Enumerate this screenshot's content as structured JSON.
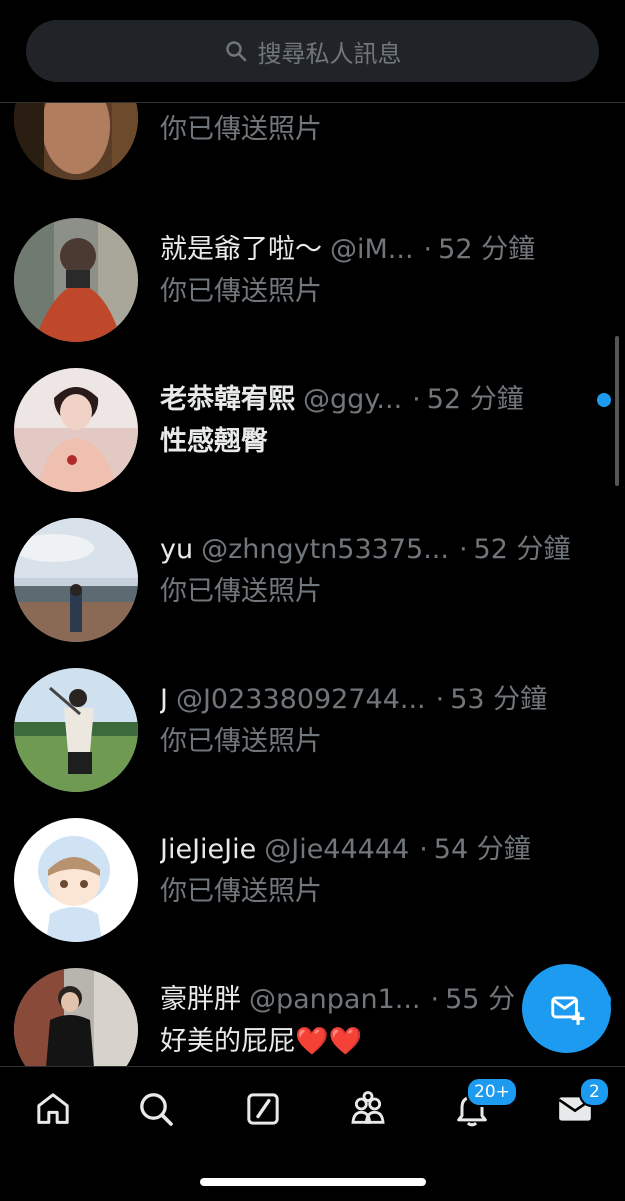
{
  "search": {
    "placeholder": "搜尋私人訊息",
    "icon": "search-icon"
  },
  "conversations": [
    {
      "name": "",
      "handle": "",
      "time": "",
      "preview": "你已傳送照片",
      "unread": false
    },
    {
      "name": "就是爺了啦～",
      "handle": "@iM...",
      "time": "52 分鐘",
      "preview": "你已傳送照片",
      "unread": false
    },
    {
      "name": "老恭韓宥熙",
      "handle": "@ggy...",
      "time": "52 分鐘",
      "preview": "性感翹臀",
      "unread": true
    },
    {
      "name": "yu",
      "handle": "@zhngytn53375...",
      "time": "52 分鐘",
      "preview": "你已傳送照片",
      "unread": false
    },
    {
      "name": "J",
      "handle": "@J02338092744...",
      "time": "53 分鐘",
      "preview": "你已傳送照片",
      "unread": false
    },
    {
      "name": "JieJieJie",
      "handle": "@Jie44444",
      "time": "54 分鐘",
      "preview": "你已傳送照片",
      "unread": false
    },
    {
      "name": "豪胖胖",
      "handle": "@panpan1...",
      "time": "55 分",
      "preview": "好美的屁屁❤️❤️",
      "unread": true
    }
  ],
  "bottom_nav": {
    "items": [
      "home-icon",
      "search-icon",
      "grok-icon",
      "communities-icon",
      "notifications-icon",
      "messages-icon"
    ],
    "notifications_badge": "20+",
    "messages_badge": "2"
  },
  "fab": {
    "icon": "new-message-icon"
  },
  "colors": {
    "accent": "#1d9bf0",
    "background": "#000000",
    "secondary_text": "#71767b"
  }
}
